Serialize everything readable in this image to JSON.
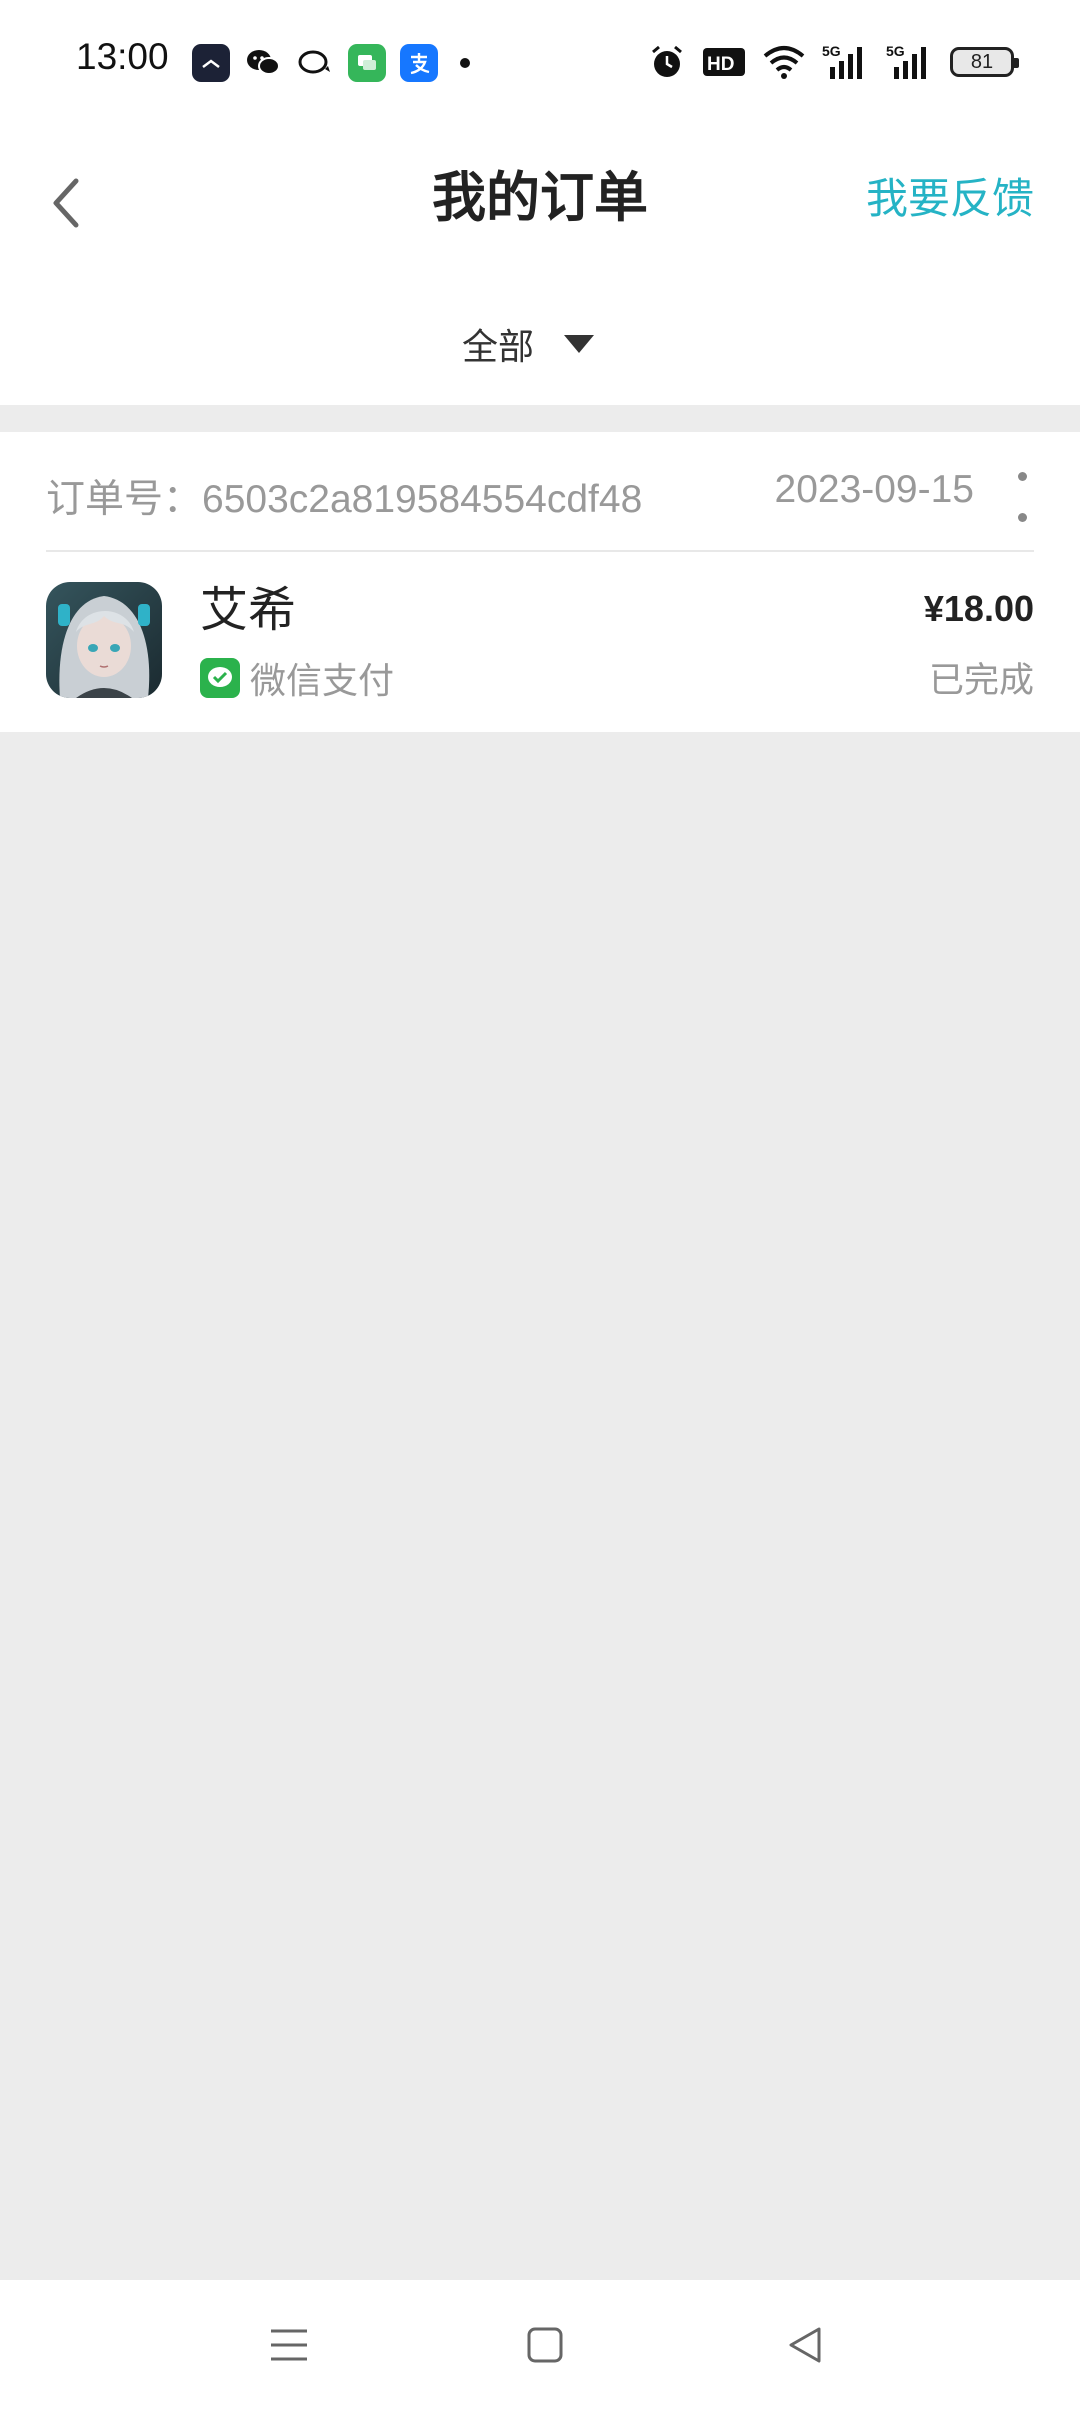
{
  "status_bar": {
    "time": "13:00",
    "app_icons": [
      "clock-app-icon",
      "wechat-icon",
      "chat-bubble-icon",
      "messages-icon",
      "alipay-icon"
    ],
    "right_icons": [
      "alarm-icon",
      "hd-icon",
      "wifi-icon",
      "signal-5g-icon",
      "signal-5g-icon"
    ],
    "hd_label": "HD",
    "net_label": "5G",
    "battery": "81"
  },
  "header": {
    "title": "我的订单",
    "feedback_label": "我要反馈"
  },
  "filter": {
    "selected": "全部"
  },
  "order": {
    "number": "订单号：6503c2a819584554cdf48",
    "date": "2023-09-15",
    "product_name": "艾希",
    "payment_method": "微信支付",
    "price": "¥18.00",
    "status": "已完成"
  },
  "colors": {
    "accent": "#25b3c5",
    "wechat_green": "#2bb24c",
    "page_bg": "#ececec"
  }
}
